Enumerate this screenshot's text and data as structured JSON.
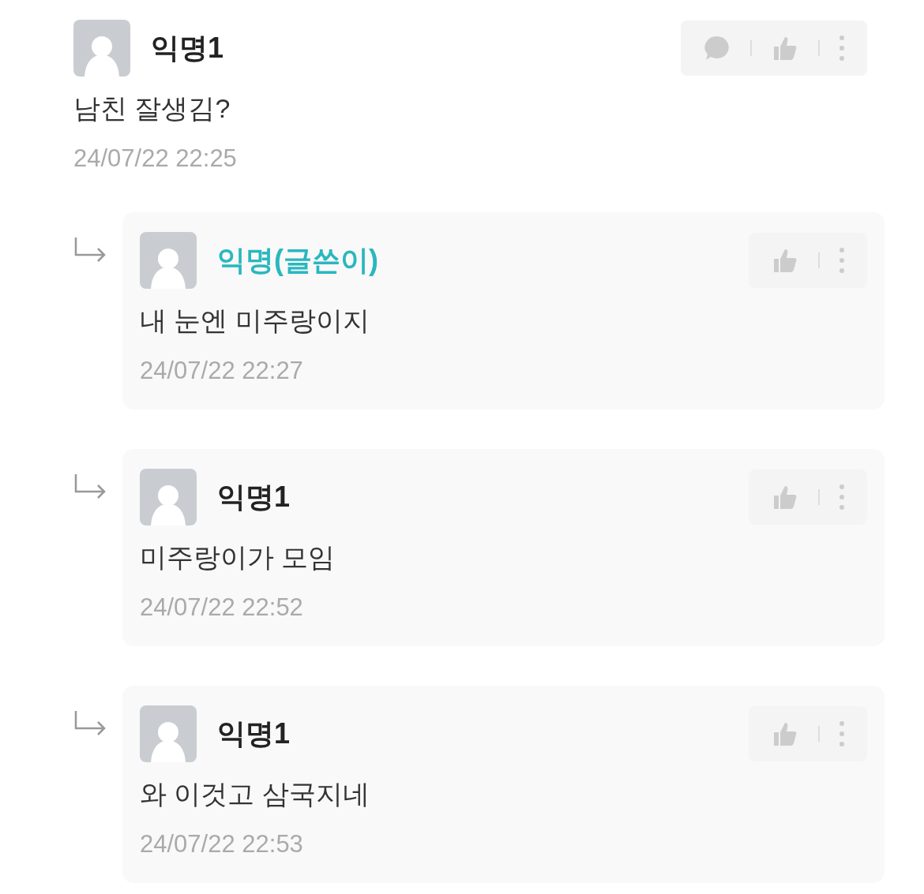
{
  "comment": {
    "author": "익명1",
    "kind": "anonymous",
    "text": "남친 잘생김?",
    "time": "24/07/22 22:25",
    "reply_action": true
  },
  "replies": [
    {
      "author": "익명(글쓴이)",
      "kind": "writer",
      "text": "내 눈엔 미주랑이지",
      "time": "24/07/22 22:27"
    },
    {
      "author": "익명1",
      "kind": "anonymous",
      "text": "미주랑이가 모임",
      "time": "24/07/22 22:52"
    },
    {
      "author": "익명1",
      "kind": "anonymous",
      "text": "와 이것고 삼국지네",
      "time": "24/07/22 22:53"
    }
  ]
}
